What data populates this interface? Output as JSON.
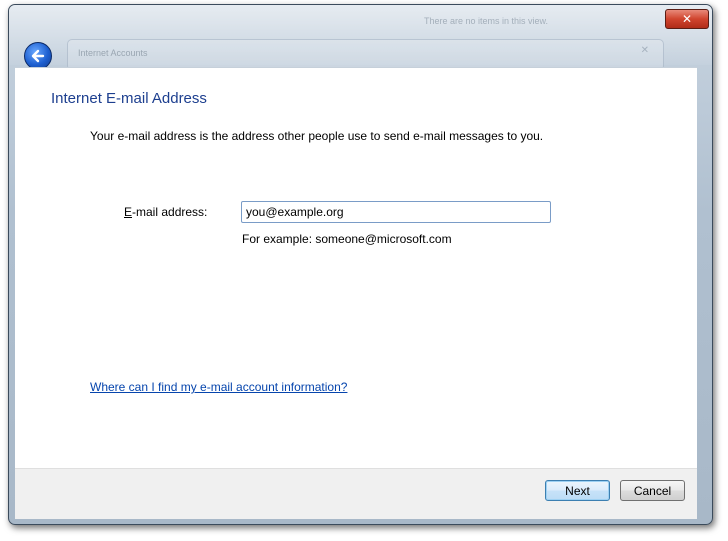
{
  "window": {
    "background_title": "There are no items in this view.",
    "address_ghost": "Internet Accounts",
    "close_glyph": "✕",
    "ghost_close_glyph": "✕"
  },
  "page": {
    "heading": "Internet E-mail Address",
    "description": "Your e-mail address is the address other people use to send e-mail messages to you."
  },
  "email": {
    "label_access_key": "E",
    "label_rest": "-mail address:",
    "value": "you@example.org",
    "example": "For example: someone@microsoft.com"
  },
  "help_link": "Where can I find my e-mail account information?",
  "buttons": {
    "next": "Next",
    "cancel": "Cancel"
  },
  "icons": {
    "back": "back-arrow-icon",
    "close": "close-icon"
  },
  "colors": {
    "heading": "#1d3f8f",
    "link": "#0645ad",
    "close_button": "#d0442e",
    "back_button": "#1d5fd0"
  }
}
